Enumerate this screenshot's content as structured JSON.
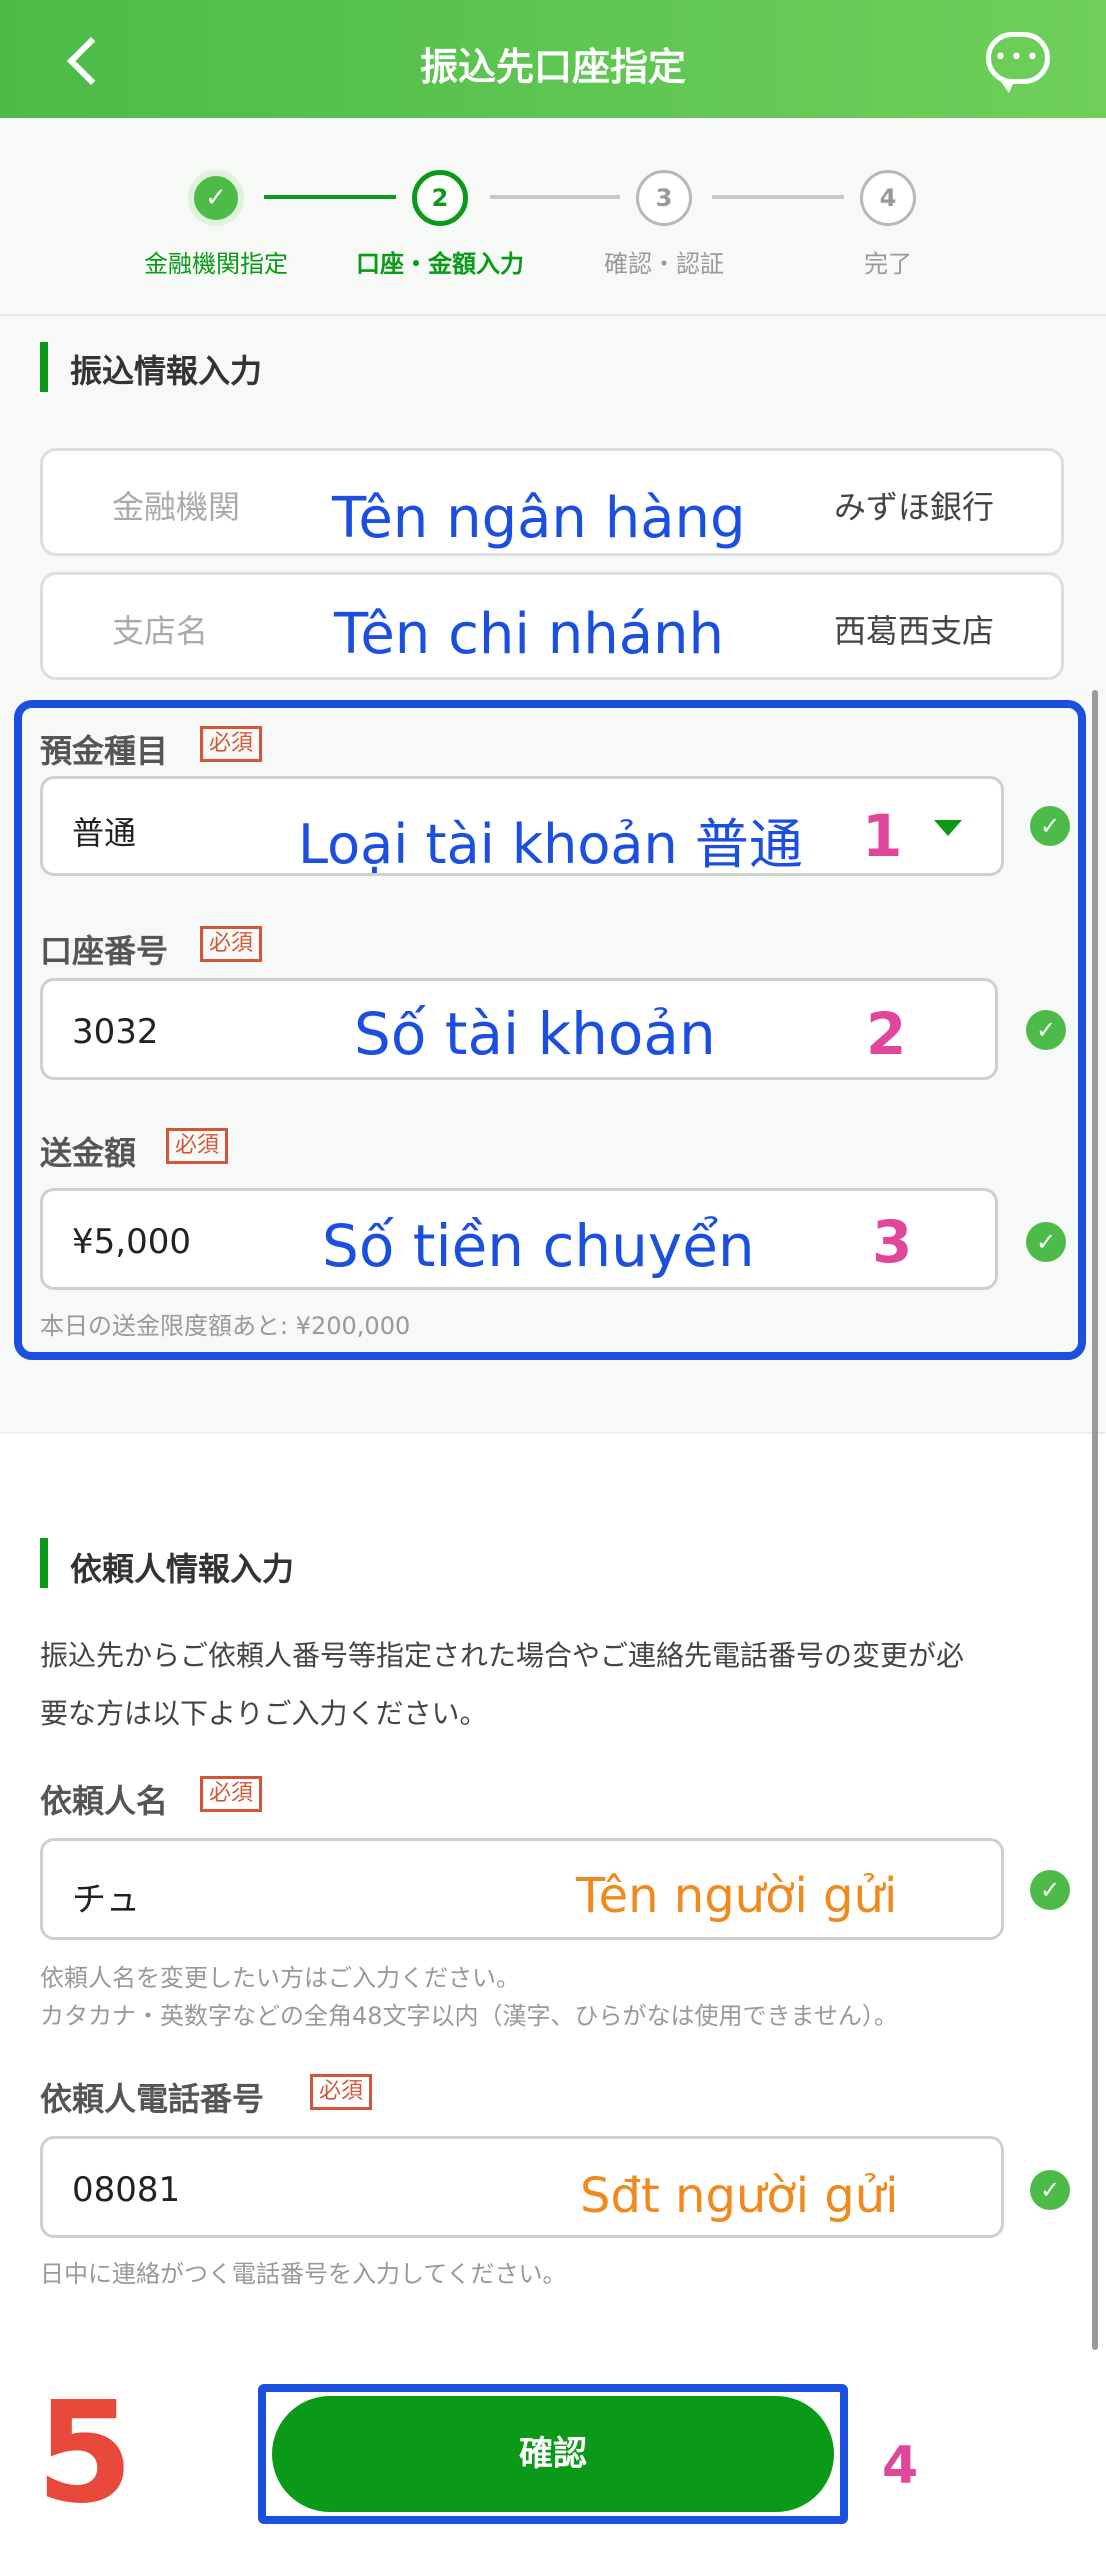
{
  "header": {
    "title": "振込先口座指定",
    "back_icon": "chevron-left-icon",
    "chat_icon": "chat-bubble-icon",
    "chat_dots": "•••"
  },
  "stepper": {
    "steps": [
      {
        "number": "✓",
        "label": "金融機関指定",
        "state": "done"
      },
      {
        "number": "2",
        "label": "口座・金額入力",
        "state": "active"
      },
      {
        "number": "3",
        "label": "確認・認証",
        "state": "todo"
      },
      {
        "number": "4",
        "label": "完了",
        "state": "todo"
      }
    ]
  },
  "transfer_section": {
    "title": "振込情報入力",
    "bank": {
      "label": "金融機関",
      "value": "みずほ銀行",
      "annotation": "Tên ngân hàng"
    },
    "branch": {
      "label": "支店名",
      "value": "西葛西支店",
      "annotation": "Tên chi nhánh"
    },
    "account_type": {
      "label": "預金種目",
      "required": "必須",
      "value": "普通",
      "annotation": "Loại tài khoản 普通",
      "step": "1"
    },
    "account_number": {
      "label": "口座番号",
      "required": "必須",
      "value": "3032",
      "annotation": "Số tài khoản",
      "step": "2"
    },
    "amount": {
      "label": "送金額",
      "required": "必須",
      "value": "¥5,000",
      "annotation": "Số tiền chuyển",
      "step": "3",
      "hint": "本日の送金限度額あと: ¥200,000"
    }
  },
  "sender_section": {
    "title": "依頼人情報入力",
    "description_line1": "振込先からご依頼人番号等指定された場合やご連絡先電話番号の変更が必",
    "description_line2": "要な方は以下よりご入力ください。",
    "name": {
      "label": "依頼人名",
      "required": "必須",
      "value": "チュ",
      "annotation": "Tên người gửi",
      "hint_line1": "依頼人名を変更したい方はご入力ください。",
      "hint_line2": "カタカナ・英数字などの全角48文字以内（漢字、ひらがなは使用できません）。"
    },
    "phone": {
      "label": "依頼人電話番号",
      "required": "必須",
      "value": "08081",
      "annotation": "Sđt người gửi",
      "hint": "日中に連絡がつく電話番号を入力してください。"
    }
  },
  "confirm_button": {
    "label": "確認",
    "annotation": "4"
  },
  "corner_annotation": "5",
  "colors": {
    "brand_green": "#0a9a18",
    "header_green": "#4cbb48",
    "annotation_blue": "#1a4fe0",
    "annotation_pink": "#e0479a",
    "annotation_orange": "#f08a1e",
    "required_red": "#d4563a"
  }
}
